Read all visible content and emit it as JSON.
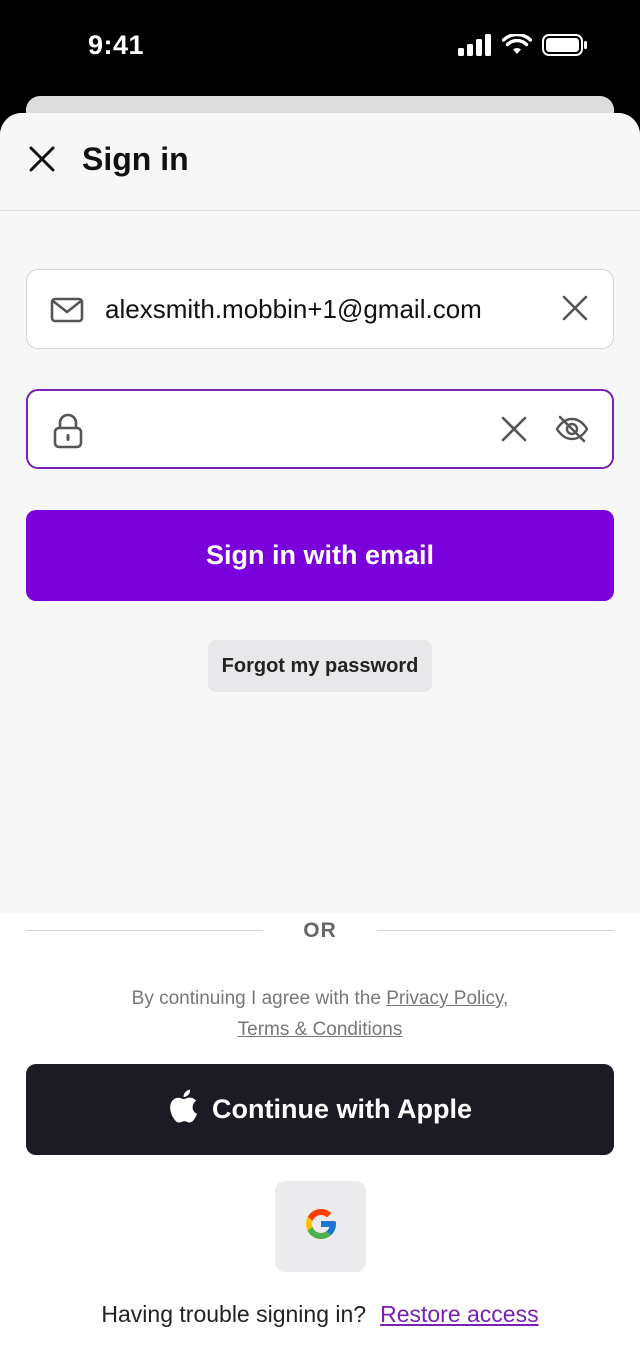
{
  "status_bar": {
    "time": "9:41",
    "icons": [
      "signal-icon",
      "wifi-icon",
      "battery-icon"
    ]
  },
  "header": {
    "title": "Sign in",
    "close_icon": "close-icon"
  },
  "email_field": {
    "value": "alexsmith.mobbin+1@gmail.com",
    "icon": "mail-icon",
    "clear_icon": "clear-icon"
  },
  "password_field": {
    "value": "",
    "placeholder": "",
    "icon": "lock-icon",
    "clear_icon": "clear-icon",
    "visibility_icon": "eye-off-icon"
  },
  "sign_in_button": {
    "label": "Sign in with email"
  },
  "forgot_button": {
    "label": "Forgot my password"
  },
  "divider": {
    "label": "OR"
  },
  "legal": {
    "prefix": "By continuing I agree with the",
    "privacy_link": "Privacy Policy,",
    "terms_link": "Terms & Conditions"
  },
  "apple_button": {
    "label": "Continue with Apple",
    "icon": "apple-icon"
  },
  "google_button": {
    "icon": "google-icon"
  },
  "footer": {
    "question": "Having trouble signing in?",
    "restore_link": "Restore access"
  },
  "colors": {
    "accent": "#7a00dc",
    "focus_border": "#7a20b5",
    "apple_bg": "#1c1a22"
  }
}
